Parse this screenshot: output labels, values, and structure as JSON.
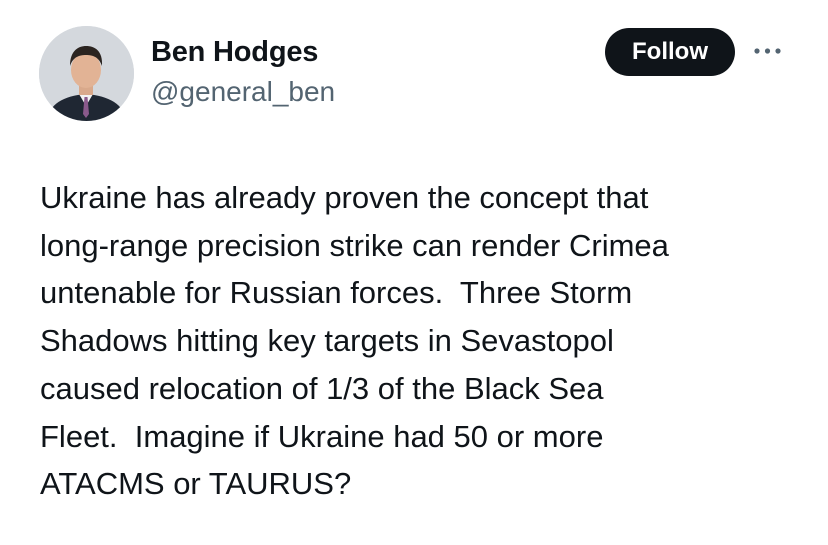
{
  "author": {
    "display_name": "Ben Hodges",
    "handle": "@general_ben",
    "avatar_icon": "profile-photo"
  },
  "actions": {
    "follow_label": "Follow",
    "more_icon": "more-horizontal-icon"
  },
  "tweet": {
    "lines": [
      "Ukraine has already proven the concept that",
      "long-range precision strike can render Crimea",
      "untenable for Russian forces.  Three Storm",
      "Shadows hitting key targets in Sevastopol",
      "caused relocation of 1/3 of the Black Sea",
      "Fleet.  Imagine if Ukraine had 50 or more",
      "ATACMS or TAURUS?"
    ]
  },
  "colors": {
    "text_primary": "#0f1419",
    "text_secondary": "#536471",
    "button_bg": "#0f1419",
    "button_text": "#ffffff",
    "background": "#ffffff"
  }
}
